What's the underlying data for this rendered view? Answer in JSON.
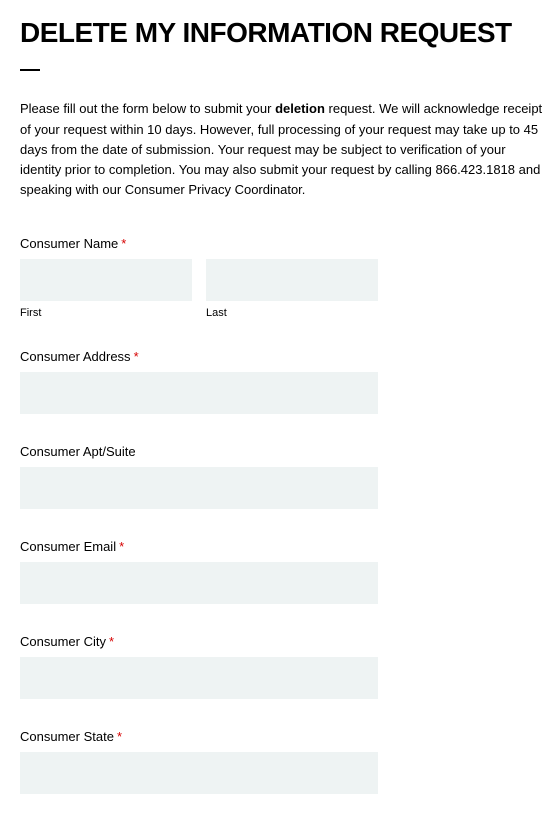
{
  "title": "DELETE MY INFORMATION REQUEST",
  "intro_parts": {
    "before_bold": "Please fill out the form below to submit your ",
    "bold": "deletion",
    "after_bold": " request. We will acknowledge receipt of your request within 10 days.  However, full processing of your request may take up to 45 days from the date of submission. Your request may be subject to verification of your identity prior to completion.  You may also submit your request by calling 866.423.1818 and speaking with our Consumer Privacy Coordinator."
  },
  "fields": {
    "name": {
      "label": "Consumer Name",
      "required": true,
      "first_sublabel": "First",
      "last_sublabel": "Last"
    },
    "address": {
      "label": "Consumer Address",
      "required": true
    },
    "apt": {
      "label": "Consumer Apt/Suite",
      "required": false
    },
    "email": {
      "label": "Consumer Email",
      "required": true
    },
    "city": {
      "label": "Consumer City",
      "required": true
    },
    "state": {
      "label": "Consumer State",
      "required": true
    }
  },
  "asterisk": "*"
}
